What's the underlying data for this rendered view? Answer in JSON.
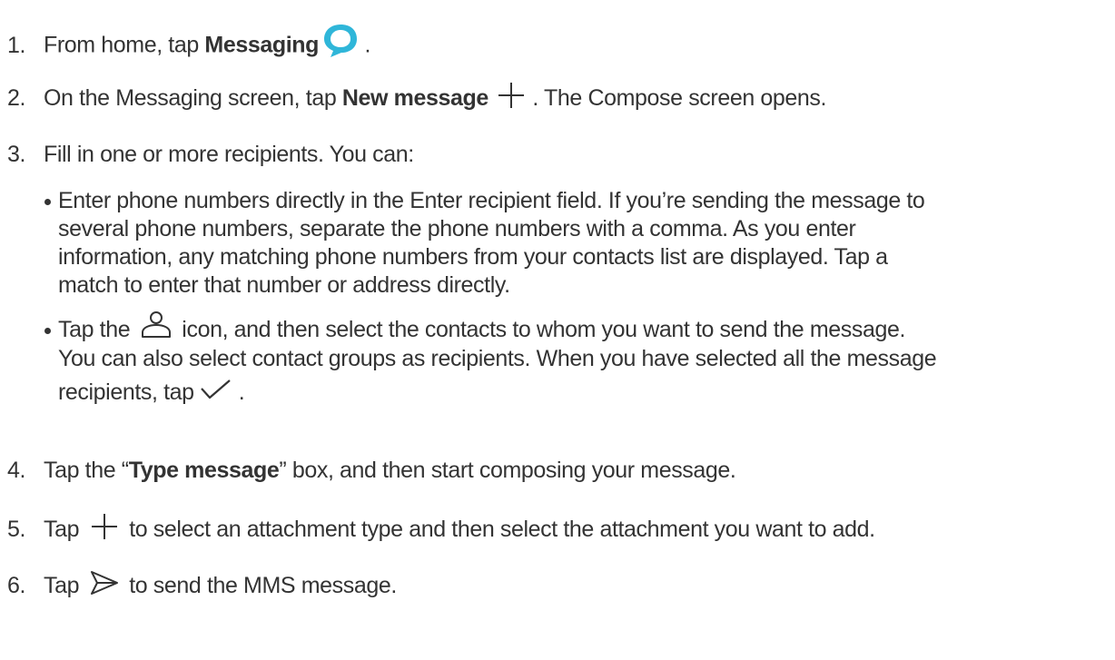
{
  "steps": [
    {
      "num": "1.",
      "pre": "From home, tap ",
      "bold": "Messaging",
      "post": " ."
    },
    {
      "num": "2.",
      "pre": "On the Messaging screen, tap ",
      "bold": "New message",
      "post": " . The Compose screen opens."
    },
    {
      "num": "3.",
      "text": "Fill in one or more recipients. You can:"
    },
    {
      "num": "4.",
      "pre": "Tap the “",
      "bold": "Type message",
      "post": "” box, and then start composing your message."
    },
    {
      "num": "5.",
      "pre": "Tap ",
      "post": " to select an attachment type and then select the attachment you want to add."
    },
    {
      "num": "6.",
      "pre": "Tap ",
      "post": " to send the MMS message."
    }
  ],
  "bullets": [
    {
      "lines": [
        "Enter phone numbers directly in the Enter recipient field. If you’re sending the message to",
        "several phone numbers, separate the phone numbers with a comma. As you enter",
        "information, any matching phone numbers from your contacts list are displayed. Tap a",
        "match to enter that number or address directly."
      ]
    },
    {
      "line1_pre": "Tap the ",
      "line1_post": " icon, and then select the contacts to whom you want to send the message.",
      "line2": "You can also select contact groups as recipients. When you have selected all the message",
      "line3_pre": "recipients, tap ",
      "line3_post": " ."
    }
  ],
  "icons": {
    "messaging": "messaging-bubble-icon",
    "new_message": "plus-icon",
    "contacts": "person-icon",
    "done": "checkmark-icon",
    "attach": "plus-icon",
    "send": "send-arrow-icon"
  },
  "colors": {
    "text": "#333333",
    "messaging_icon": "#2fb6d9"
  }
}
